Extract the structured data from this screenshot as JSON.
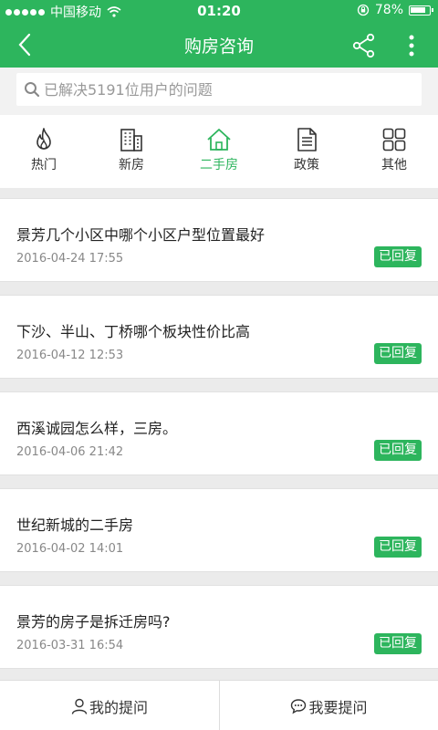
{
  "status_bar": {
    "carrier": "中国移动",
    "time": "01:20",
    "battery": "78%"
  },
  "navbar": {
    "title": "购房咨询"
  },
  "search": {
    "placeholder": "已解决5191位用户的问题"
  },
  "tabs": [
    {
      "label": "热门",
      "icon": "flame-icon"
    },
    {
      "label": "新房",
      "icon": "building-icon"
    },
    {
      "label": "二手房",
      "icon": "house-icon",
      "active": true
    },
    {
      "label": "政策",
      "icon": "document-icon"
    },
    {
      "label": "其他",
      "icon": "grid-icon"
    }
  ],
  "questions": [
    {
      "title": "景芳几个小区中哪个小区户型位置最好",
      "date": "2016-04-24 17:55",
      "status": "已回复"
    },
    {
      "title": "下沙、半山、丁桥哪个板块性价比高",
      "date": "2016-04-12 12:53",
      "status": "已回复"
    },
    {
      "title": "西溪诚园怎么样，三房。",
      "date": "2016-04-06 21:42",
      "status": "已回复"
    },
    {
      "title": "世纪新城的二手房",
      "date": "2016-04-02 14:01",
      "status": "已回复"
    },
    {
      "title": "景芳的房子是拆迁房吗?",
      "date": "2016-03-31 16:54",
      "status": "已回复"
    }
  ],
  "bottom_bar": {
    "my_questions": "我的提问",
    "ask_question": "我要提问"
  },
  "colors": {
    "accent": "#2db55d",
    "background": "#ebebeb"
  }
}
